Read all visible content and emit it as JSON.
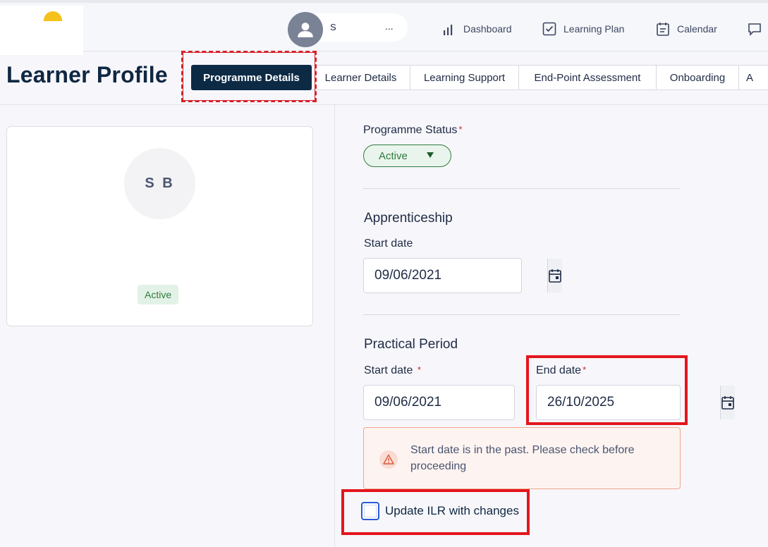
{
  "topbar": {
    "user_name": "S",
    "user_more": "...",
    "nav": [
      {
        "label": "Dashboard",
        "icon": "bar-chart-icon"
      },
      {
        "label": "Learning Plan",
        "icon": "checkbox-icon"
      },
      {
        "label": "Calendar",
        "icon": "calendar-icon"
      }
    ]
  },
  "page": {
    "title": "Learner Profile"
  },
  "tabs": [
    {
      "label": "Programme Details",
      "active": true
    },
    {
      "label": "Learner Details",
      "active": false
    },
    {
      "label": "Learning Support",
      "active": false
    },
    {
      "label": "End-Point Assessment",
      "active": false
    },
    {
      "label": "Onboarding",
      "active": false
    },
    {
      "label": "A",
      "active": false
    }
  ],
  "profile_card": {
    "initials": "S B",
    "status_badge": "Active"
  },
  "form": {
    "programme_status_label": "Programme Status",
    "programme_status_value": "Active",
    "apprenticeship": {
      "title": "Apprenticeship",
      "start_date_label": "Start date",
      "start_date_value": "09/06/2021"
    },
    "practical_period": {
      "title": "Practical Period",
      "start_date_label": "Start date",
      "start_date_value": "09/06/2021",
      "end_date_label": "End date",
      "end_date_value": "26/10/2025"
    },
    "warning_text": "Start date is in the past. Please check before proceeding",
    "update_ilr_label": "Update ILR with changes",
    "required_mark": "*"
  },
  "colors": {
    "brand_dark": "#0d2a45",
    "status_green": "#2f7a3d",
    "highlight_red": "#e3161e",
    "warning_border": "#f0a78d",
    "logo_yellow": "#f4c21b"
  }
}
